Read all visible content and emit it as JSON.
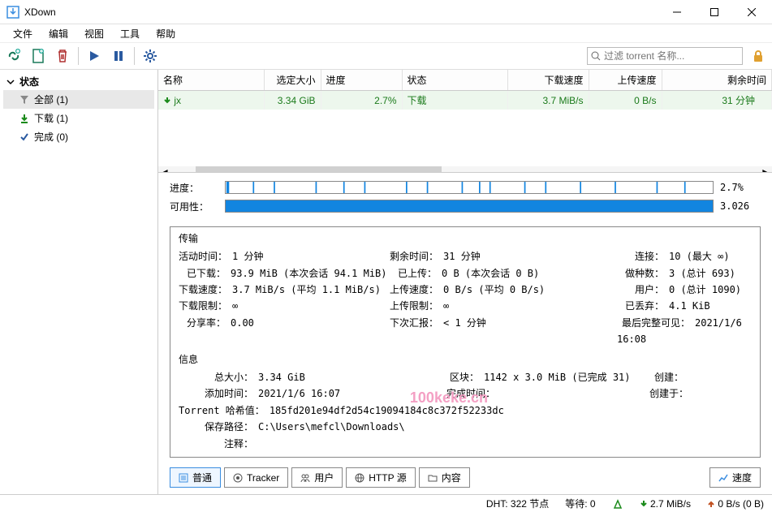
{
  "window": {
    "title": "XDown"
  },
  "menu": {
    "file": "文件",
    "edit": "编辑",
    "view": "视图",
    "tools": "工具",
    "help": "帮助"
  },
  "toolbar": {
    "filter_placeholder": "过滤 torrent 名称..."
  },
  "sidebar": {
    "header": "状态",
    "items": [
      {
        "label": "全部 (1)"
      },
      {
        "label": "下载 (1)"
      },
      {
        "label": "完成 (0)"
      }
    ]
  },
  "columns": {
    "name": "名称",
    "size": "选定大小",
    "progress": "进度",
    "status": "状态",
    "dlspeed": "下载速度",
    "upspeed": "上传速度",
    "eta": "剩余时间"
  },
  "rows": [
    {
      "name": "jx",
      "size": "3.34 GiB",
      "progress": "2.7%",
      "progress_pct": 2.7,
      "status": "下载",
      "dlspeed": "3.7 MiB/s",
      "upspeed": "0 B/s",
      "eta": "31 分钟"
    }
  ],
  "detail": {
    "progress_label": "进度：",
    "progress_val": "2.7%",
    "avail_label": "可用性：",
    "avail_val": "3.026",
    "transfer_header": "传输",
    "active_label": "活动时间：",
    "active_val": "1 分钟",
    "eta_label": "剩余时间：",
    "eta_val": "31 分钟",
    "conn_label": "连接：",
    "conn_val": "10 (最大 ∞)",
    "dl_label": "已下载：",
    "dl_val": "93.9 MiB (本次会话 94.1 MiB)",
    "ul_label": "已上传：",
    "ul_val": "0 B (本次会话 0 B)",
    "seeds_label": "做种数：",
    "seeds_val": "3 (总计 693)",
    "dlspd_label": "下载速度：",
    "dlspd_val": "3.7 MiB/s (平均 1.1 MiB/s)",
    "ulspd_label": "上传速度：",
    "ulspd_val": "0 B/s (平均 0 B/s)",
    "peers_label": "用户：",
    "peers_val": "0 (总计 1090)",
    "dllim_label": "下载限制：",
    "dllim_val": "∞",
    "ullim_label": "上传限制：",
    "ullim_val": "∞",
    "wasted_label": "已丢弃：",
    "wasted_val": "4.1 KiB",
    "ratio_label": "分享率：",
    "ratio_val": "0.00",
    "reann_label": "下次汇报：",
    "reann_val": "< 1 分钟",
    "lastseen_label": "最后完整可见：",
    "lastseen_val": "2021/1/6 16:08",
    "info_header": "信息",
    "total_label": "总大小：",
    "total_val": "3.34 GiB",
    "pieces_label": "区块：",
    "pieces_val": "1142 x 3.0 MiB (已完成 31)",
    "created_label": "创建：",
    "created_val": "",
    "added_label": "添加时间：",
    "added_val": "2021/1/6 16:07",
    "completed_label": "完成时间：",
    "completed_val": "",
    "createdby_label": "创建于：",
    "createdby_val": "",
    "hash_label": "Torrent 哈希值：",
    "hash_val": "185fd201e94df2d54c19094184c8c372f52233dc",
    "save_label": "保存路径：",
    "save_val": "C:\\Users\\mefcl\\Downloads\\",
    "comment_label": "注释：",
    "comment_val": ""
  },
  "tabs": {
    "general": "普通",
    "tracker": "Tracker",
    "peers": "用户",
    "http": "HTTP 源",
    "content": "内容",
    "speed": "速度"
  },
  "status": {
    "dht": "DHT: 322 节点",
    "wait": "等待: 0",
    "dl": "2.7 MiB/s",
    "ul": "0 B/s (0 B)"
  },
  "watermark": "100keke.cn"
}
